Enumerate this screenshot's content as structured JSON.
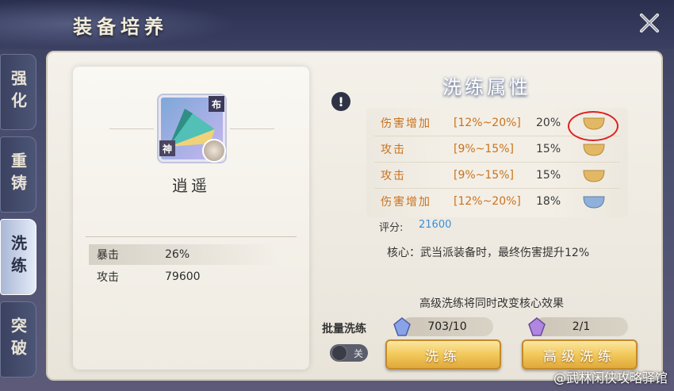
{
  "header": {
    "title": "装备培养"
  },
  "tabs": [
    {
      "label": "强化",
      "active": false
    },
    {
      "label": "重铸",
      "active": false
    },
    {
      "label": "洗练",
      "active": true
    },
    {
      "label": "突破",
      "active": false
    }
  ],
  "item": {
    "name": "逍遥",
    "badge_top": "布",
    "badge_bottom": "神",
    "stats": [
      {
        "label": "暴击",
        "value": "26%"
      },
      {
        "label": "攻击",
        "value": "79600"
      }
    ]
  },
  "wash": {
    "title": "洗练属性",
    "attributes": [
      {
        "name": "伤害增加",
        "range": "[12%~20%]",
        "value": "20%",
        "lock_color": "#e3b865"
      },
      {
        "name": "攻击",
        "range": "[9%~15%]",
        "value": "15%",
        "lock_color": "#e3b865"
      },
      {
        "name": "攻击",
        "range": "[9%~15%]",
        "value": "15%",
        "lock_color": "#e3b865"
      },
      {
        "name": "伤害增加",
        "range": "[12%~20%]",
        "value": "18%",
        "lock_color": "#8fb0d8"
      }
    ],
    "score_label": "评分:",
    "score_value": "21600",
    "core_text": "核心：武当派装备时，最终伤害提升12%",
    "hint": "高级洗练将同时改变核心效果",
    "batch_label": "批量洗练",
    "normal_cost": "703/10",
    "advanced_cost": "2/1",
    "toggle_label": "关",
    "wash_button": "洗练",
    "advanced_button": "高级洗练"
  },
  "watermark": "@武林闲侠攻略驿馆"
}
